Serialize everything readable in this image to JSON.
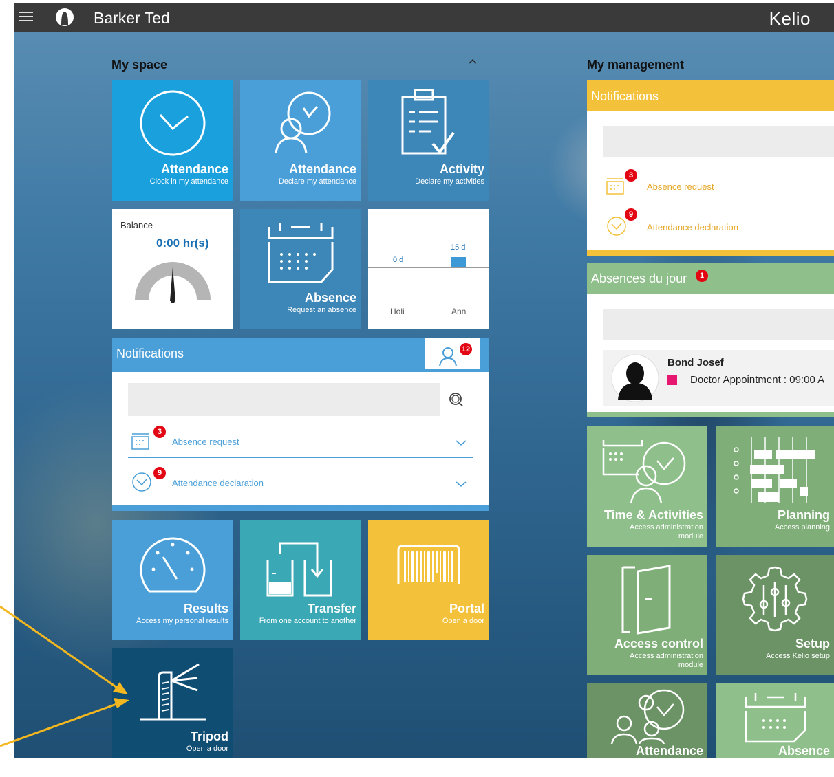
{
  "topbar": {
    "user_name": "Barker Ted",
    "brand": "Kelio"
  },
  "my_space": {
    "title": "My space",
    "tiles": {
      "attendance_clock": {
        "title": "Attendance",
        "subtitle": "Clock in my attendance"
      },
      "attendance_declare": {
        "title": "Attendance",
        "subtitle": "Declare my attendance"
      },
      "activity": {
        "title": "Activity",
        "subtitle": "Declare my activities"
      },
      "balance": {
        "label": "Balance",
        "value": "0:00 hr(s)"
      },
      "absence": {
        "title": "Absence",
        "subtitle": "Request an absence"
      },
      "counters": {
        "bars": [
          {
            "label": "Holi",
            "value_label": "0 d",
            "value": 0
          },
          {
            "label": "Ann",
            "value_label": "15 d",
            "value": 15
          }
        ]
      },
      "results": {
        "title": "Results",
        "subtitle": "Access my personal results"
      },
      "transfer": {
        "title": "Transfer",
        "subtitle": "From one account to another"
      },
      "portal": {
        "title": "Portal",
        "subtitle": "Open a door"
      },
      "tripod": {
        "title": "Tripod",
        "subtitle": "Open a door"
      }
    },
    "notifications": {
      "title": "Notifications",
      "badge": "12",
      "items": [
        {
          "label": "Absence request",
          "count": "3"
        },
        {
          "label": "Attendance declaration",
          "count": "9"
        }
      ]
    }
  },
  "my_management": {
    "title": "My management",
    "notifications": {
      "title": "Notifications",
      "items": [
        {
          "label": "Absence request",
          "count": "3"
        },
        {
          "label": "Attendance declaration",
          "count": "9"
        }
      ]
    },
    "absences_today": {
      "title": "Absences du jour",
      "badge": "1",
      "person": {
        "name": "Bond Josef",
        "detail": "Doctor Appointment : 09:00 A"
      }
    },
    "tiles": {
      "time_activities": {
        "title": "Time & Activities",
        "subtitle_line1": "Access administration",
        "subtitle_line2": "module"
      },
      "planning": {
        "title": "Planning",
        "subtitle": "Access planning"
      },
      "access_control": {
        "title": "Access control",
        "subtitle_line1": "Access administration",
        "subtitle_line2": "module"
      },
      "setup": {
        "title": "Setup",
        "subtitle": "Access Kelio setup"
      },
      "attendance": {
        "title": "Attendance"
      },
      "absence": {
        "title": "Absence"
      }
    }
  },
  "colors": {
    "blue_dark": "#1aa0dc",
    "blue_mid": "#4a9fd8",
    "blue_steel": "#3d86b8",
    "teal": "#3aa9b5",
    "yellow": "#f3c13a",
    "navy": "#0f4d73",
    "green_light": "#8fbf8a",
    "green_mid": "#7fae78",
    "green_dark": "#6b9365",
    "badge_red": "#e30613",
    "annotation_arrow": "#f3b720"
  }
}
